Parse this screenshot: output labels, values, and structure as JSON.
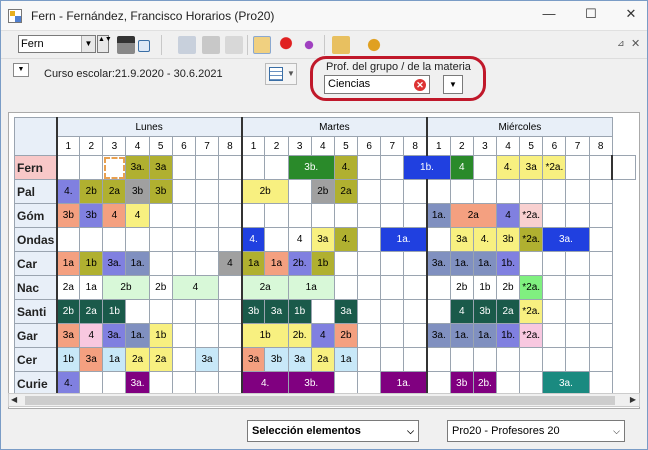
{
  "window": {
    "title": "Fern - Fernández, Francisco  Horarios  (Pro20)",
    "minimize": "—",
    "maximize": "☐",
    "close": "✕"
  },
  "toolbar": {
    "element_value": "Fern",
    "spin": "▲▼",
    "dropdown_arrow": "▼",
    "pin": "⊿",
    "close": "✕"
  },
  "info": {
    "menu_arrow": "▼",
    "school_year": "Curso escolar:21.9.2020 - 30.6.2021",
    "filter_label": "Prof. del grupo / de la materia",
    "filter_value": "Ciencias",
    "clear": "✕",
    "filter_arrow": "▼",
    "timetable_arrow": "▼"
  },
  "grid": {
    "days": [
      "Lunes",
      "Martes",
      "Miércoles"
    ],
    "periods": [
      "1",
      "2",
      "3",
      "4",
      "5",
      "6",
      "7",
      "8",
      "1",
      "2",
      "3",
      "4",
      "5",
      "6",
      "7",
      "8",
      "1",
      "2",
      "3",
      "4",
      "5",
      "6",
      "7",
      "8"
    ],
    "rows": [
      {
        "label": "Fern",
        "label_color": "#f8c8c8",
        "cells": [
          {
            "t": ""
          },
          {
            "t": ""
          },
          {
            "t": "",
            "sel": true
          },
          {
            "t": "3a.",
            "c": "#b0b030"
          },
          {
            "t": "3a",
            "c": "#b0b030"
          },
          {
            "t": ""
          },
          {
            "t": ""
          },
          {
            "t": ""
          },
          {
            "t": ""
          },
          {
            "t": ""
          },
          {
            "t": "3b.",
            "c": "#2a8a2a",
            "span": 2,
            "fc": "#fff"
          },
          {
            "t": "4.",
            "c": "#b0b030"
          },
          {
            "t": ""
          },
          {
            "t": ""
          },
          {
            "t": "1b.",
            "c": "#2040e0",
            "span": 2,
            "fc": "#fff"
          },
          {
            "t": "4",
            "c": "#2a8a2a",
            "fc": "#fff"
          },
          {
            "t": ""
          },
          {
            "t": "4.",
            "c": "#f8f080"
          },
          {
            "t": "3a",
            "c": "#f8f080"
          },
          {
            "t": "*2a.",
            "c": "#f8f080"
          },
          {
            "t": ""
          },
          {
            "t": ""
          },
          {
            "t": ""
          }
        ]
      },
      {
        "label": "Pal",
        "cells": [
          {
            "t": "4.",
            "c": "#8080e0"
          },
          {
            "t": "2b",
            "c": "#b0b030"
          },
          {
            "t": "2a",
            "c": "#b0b030"
          },
          {
            "t": "3b",
            "c": "#a0a0a0"
          },
          {
            "t": "3b",
            "c": "#b0b030"
          },
          {
            "t": ""
          },
          {
            "t": ""
          },
          {
            "t": ""
          },
          {
            "t": "2b",
            "c": "#f8f080",
            "span": 2
          },
          {
            "t": ""
          },
          {
            "t": "2b",
            "c": "#a0a0a0"
          },
          {
            "t": "2a",
            "c": "#b0b030"
          },
          {
            "t": ""
          },
          {
            "t": ""
          },
          {
            "t": ""
          },
          {
            "t": ""
          },
          {
            "t": ""
          },
          {
            "t": ""
          },
          {
            "t": ""
          },
          {
            "t": ""
          },
          {
            "t": ""
          },
          {
            "t": ""
          },
          {
            "t": ""
          }
        ]
      },
      {
        "label": "Góm",
        "cells": [
          {
            "t": "3b",
            "c": "#f4a080"
          },
          {
            "t": "3b",
            "c": "#8080e0"
          },
          {
            "t": "4",
            "c": "#f4a080"
          },
          {
            "t": "4",
            "c": "#f8f080"
          },
          {
            "t": ""
          },
          {
            "t": ""
          },
          {
            "t": ""
          },
          {
            "t": ""
          },
          {
            "t": ""
          },
          {
            "t": ""
          },
          {
            "t": ""
          },
          {
            "t": ""
          },
          {
            "t": ""
          },
          {
            "t": ""
          },
          {
            "t": ""
          },
          {
            "t": ""
          },
          {
            "t": "1a.",
            "c": "#8090c0"
          },
          {
            "t": "2a",
            "c": "#f4a080",
            "span": 2
          },
          {
            "t": "4",
            "c": "#8080e0"
          },
          {
            "t": "*2a.",
            "c": "#f8d0d0"
          },
          {
            "t": ""
          },
          {
            "t": ""
          },
          {
            "t": ""
          }
        ]
      },
      {
        "label": "Ondas",
        "cells": [
          {
            "t": ""
          },
          {
            "t": ""
          },
          {
            "t": ""
          },
          {
            "t": ""
          },
          {
            "t": ""
          },
          {
            "t": ""
          },
          {
            "t": ""
          },
          {
            "t": ""
          },
          {
            "t": "4.",
            "c": "#2040e0",
            "fc": "#fff"
          },
          {
            "t": ""
          },
          {
            "t": "4"
          },
          {
            "t": "3a",
            "c": "#f8f080"
          },
          {
            "t": "4.",
            "c": "#b0b030"
          },
          {
            "t": ""
          },
          {
            "t": "1a.",
            "c": "#2040e0",
            "span": 2,
            "fc": "#fff"
          },
          {
            "t": ""
          },
          {
            "t": "3a",
            "c": "#f8f080"
          },
          {
            "t": "4.",
            "c": "#f8f080"
          },
          {
            "t": "3b",
            "c": "#f8f080"
          },
          {
            "t": "*2a.",
            "c": "#b0b030"
          },
          {
            "t": "3a.",
            "c": "#2040e0",
            "span": 2,
            "fc": "#fff"
          },
          {
            "t": ""
          }
        ]
      },
      {
        "label": "Car",
        "cells": [
          {
            "t": "1a",
            "c": "#f4a080"
          },
          {
            "t": "1b",
            "c": "#b0b030"
          },
          {
            "t": "3a.",
            "c": "#8080e0"
          },
          {
            "t": "1a.",
            "c": "#8090c0"
          },
          {
            "t": ""
          },
          {
            "t": ""
          },
          {
            "t": ""
          },
          {
            "t": "4",
            "c": "#a0a0a0"
          },
          {
            "t": "1a",
            "c": "#b0b030"
          },
          {
            "t": "1a",
            "c": "#f4a080"
          },
          {
            "t": "2b.",
            "c": "#8080e0"
          },
          {
            "t": "1b",
            "c": "#b0b030"
          },
          {
            "t": ""
          },
          {
            "t": ""
          },
          {
            "t": ""
          },
          {
            "t": ""
          },
          {
            "t": "3a.",
            "c": "#8090c0"
          },
          {
            "t": "1a.",
            "c": "#8090c0"
          },
          {
            "t": "1a.",
            "c": "#8090c0"
          },
          {
            "t": "1b.",
            "c": "#8080e0"
          },
          {
            "t": ""
          },
          {
            "t": ""
          },
          {
            "t": ""
          },
          {
            "t": ""
          }
        ]
      },
      {
        "label": "Nac",
        "cells": [
          {
            "t": "2a"
          },
          {
            "t": "1a"
          },
          {
            "t": "2b",
            "c": "#d8f8d8",
            "span": 2
          },
          {
            "t": "2b"
          },
          {
            "t": "4",
            "c": "#d8f8d8",
            "span": 2
          },
          {
            "t": ""
          },
          {
            "t": "2a",
            "c": "#d8f8d8",
            "span": 2
          },
          {
            "t": "1a",
            "c": "#d8f8d8",
            "span": 2
          },
          {
            "t": ""
          },
          {
            "t": ""
          },
          {
            "t": ""
          },
          {
            "t": ""
          },
          {
            "t": ""
          },
          {
            "t": "2b"
          },
          {
            "t": "1b"
          },
          {
            "t": "2b"
          },
          {
            "t": "*2a.",
            "c": "#80f080"
          },
          {
            "t": ""
          },
          {
            "t": ""
          },
          {
            "t": ""
          }
        ]
      },
      {
        "label": "Santi",
        "cells": [
          {
            "t": "2b",
            "c": "#1a5a4a",
            "fc": "#fff"
          },
          {
            "t": "2a",
            "c": "#1a5a4a",
            "fc": "#fff"
          },
          {
            "t": "1b",
            "c": "#1a5a4a",
            "fc": "#fff"
          },
          {
            "t": ""
          },
          {
            "t": ""
          },
          {
            "t": ""
          },
          {
            "t": ""
          },
          {
            "t": ""
          },
          {
            "t": "3b",
            "c": "#1a5a4a",
            "fc": "#fff"
          },
          {
            "t": "3a",
            "c": "#1a5a4a",
            "fc": "#fff"
          },
          {
            "t": "1b",
            "c": "#1a5a4a",
            "fc": "#fff"
          },
          {
            "t": ""
          },
          {
            "t": "3a",
            "c": "#1a5a4a",
            "fc": "#fff"
          },
          {
            "t": ""
          },
          {
            "t": ""
          },
          {
            "t": ""
          },
          {
            "t": ""
          },
          {
            "t": "4",
            "c": "#1a5a4a",
            "fc": "#fff"
          },
          {
            "t": "3b",
            "c": "#1a5a4a",
            "fc": "#fff"
          },
          {
            "t": "2a",
            "c": "#1a5a4a",
            "fc": "#fff"
          },
          {
            "t": "*2a.",
            "c": "#f8f080"
          },
          {
            "t": ""
          },
          {
            "t": ""
          },
          {
            "t": ""
          }
        ]
      },
      {
        "label": "Gar",
        "cells": [
          {
            "t": "3a",
            "c": "#f4a080"
          },
          {
            "t": "4",
            "c": "#f8c8e0"
          },
          {
            "t": "3a.",
            "c": "#8080e0"
          },
          {
            "t": "1a.",
            "c": "#8090c0"
          },
          {
            "t": "1b",
            "c": "#f8f080"
          },
          {
            "t": ""
          },
          {
            "t": ""
          },
          {
            "t": ""
          },
          {
            "t": "1b",
            "c": "#f8f080",
            "span": 2
          },
          {
            "t": "2b.",
            "c": "#f8f080"
          },
          {
            "t": "4",
            "c": "#8080e0"
          },
          {
            "t": "2b",
            "c": "#f4a080"
          },
          {
            "t": ""
          },
          {
            "t": ""
          },
          {
            "t": ""
          },
          {
            "t": "3a.",
            "c": "#8090c0"
          },
          {
            "t": "1a.",
            "c": "#8090c0"
          },
          {
            "t": "1a.",
            "c": "#8090c0"
          },
          {
            "t": "1b.",
            "c": "#8080e0"
          },
          {
            "t": "*2a.",
            "c": "#f8c8e0"
          },
          {
            "t": ""
          },
          {
            "t": ""
          },
          {
            "t": ""
          }
        ]
      },
      {
        "label": "Cer",
        "cells": [
          {
            "t": "1b",
            "c": "#c8e8f8"
          },
          {
            "t": "3a",
            "c": "#f4a080"
          },
          {
            "t": "1a",
            "c": "#c8e8f8"
          },
          {
            "t": "2a",
            "c": "#f8f080"
          },
          {
            "t": "2a",
            "c": "#f8f080"
          },
          {
            "t": ""
          },
          {
            "t": "3a",
            "c": "#c8e8f8"
          },
          {
            "t": ""
          },
          {
            "t": "3a",
            "c": "#f4a080"
          },
          {
            "t": "3b",
            "c": "#c8e8f8"
          },
          {
            "t": "3a",
            "c": "#c8e8f8"
          },
          {
            "t": "2a",
            "c": "#f8f080"
          },
          {
            "t": "1a",
            "c": "#c8e8f8"
          },
          {
            "t": ""
          },
          {
            "t": ""
          },
          {
            "t": ""
          },
          {
            "t": ""
          },
          {
            "t": ""
          },
          {
            "t": ""
          },
          {
            "t": ""
          },
          {
            "t": ""
          },
          {
            "t": ""
          },
          {
            "t": ""
          },
          {
            "t": ""
          }
        ]
      },
      {
        "label": "Curie",
        "cells": [
          {
            "t": "4.",
            "c": "#8080e0"
          },
          {
            "t": ""
          },
          {
            "t": ""
          },
          {
            "t": "3a.",
            "c": "#800080",
            "fc": "#fff"
          },
          {
            "t": ""
          },
          {
            "t": ""
          },
          {
            "t": ""
          },
          {
            "t": ""
          },
          {
            "t": "4.",
            "c": "#800080",
            "span": 2,
            "fc": "#fff"
          },
          {
            "t": "3b.",
            "c": "#800080",
            "span": 2,
            "fc": "#fff"
          },
          {
            "t": ""
          },
          {
            "t": ""
          },
          {
            "t": "1a.",
            "c": "#800080",
            "span": 2,
            "fc": "#fff"
          },
          {
            "t": ""
          },
          {
            "t": "3b",
            "c": "#800080",
            "fc": "#fff"
          },
          {
            "t": "2b.",
            "c": "#800080",
            "fc": "#fff"
          },
          {
            "t": ""
          },
          {
            "t": ""
          },
          {
            "t": "3a.",
            "c": "#1a8a80",
            "span": 2,
            "fc": "#fff"
          },
          {
            "t": ""
          }
        ]
      }
    ]
  },
  "scrollbar": {
    "left": "◀",
    "right": "▶"
  },
  "bottom": {
    "selection": "Selección elementos",
    "profesores": "Pro20 - Profesores 20",
    "arrow": "⌵"
  }
}
